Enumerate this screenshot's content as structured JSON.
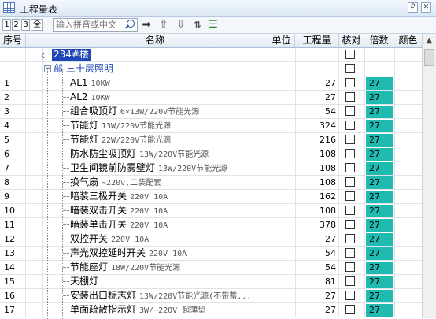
{
  "window": {
    "title": "工程量表",
    "pin_label": "₽",
    "close_label": "✕"
  },
  "toolbar": {
    "levels": [
      "1",
      "2",
      "3",
      "全"
    ],
    "search_placeholder": "输入拼音或中文",
    "icons": [
      "arrow-right-icon",
      "arrow-up-icon",
      "arrow-down-icon",
      "sort-icon",
      "list-check-icon"
    ]
  },
  "columns": {
    "seq": "序号",
    "name": "名称",
    "unit": "单位",
    "qty": "工程量",
    "check": "核对",
    "mult": "倍数",
    "color": "颜色"
  },
  "tree": {
    "root": {
      "prefix": "X",
      "label": "234#楼"
    },
    "group": {
      "prefix": "部",
      "label": "三十层照明"
    }
  },
  "rows": [
    {
      "no": "1",
      "name": "AL1",
      "spec": "10KW",
      "qty": "27",
      "mult": "27"
    },
    {
      "no": "2",
      "name": "AL2",
      "spec": "10KW",
      "qty": "27",
      "mult": "27"
    },
    {
      "no": "3",
      "name": "组合吸顶灯",
      "spec": "6×13W/220V节能光源",
      "qty": "54",
      "mult": "27"
    },
    {
      "no": "4",
      "name": "节能灯",
      "spec": "13W/220V节能光源",
      "qty": "324",
      "mult": "27"
    },
    {
      "no": "5",
      "name": "节能灯",
      "spec": "22W/220V节能光源",
      "qty": "216",
      "mult": "27"
    },
    {
      "no": "6",
      "name": "防水防尘吸顶灯",
      "spec": "13W/220V节能光源",
      "qty": "108",
      "mult": "27"
    },
    {
      "no": "7",
      "name": "卫生间镜前防雾壁灯",
      "spec": "13W/220V节能光源",
      "qty": "108",
      "mult": "27"
    },
    {
      "no": "8",
      "name": "换气扇",
      "spec": "~220v,二装配套",
      "qty": "108",
      "mult": "27"
    },
    {
      "no": "9",
      "name": "暗装三极开关",
      "spec": "220V 10A",
      "qty": "162",
      "mult": "27"
    },
    {
      "no": "10",
      "name": "暗装双击开关",
      "spec": "220V 10A",
      "qty": "108",
      "mult": "27"
    },
    {
      "no": "11",
      "name": "暗装单击开关",
      "spec": "220V 10A",
      "qty": "378",
      "mult": "27"
    },
    {
      "no": "12",
      "name": "双控开关",
      "spec": "220V 10A",
      "qty": "27",
      "mult": "27"
    },
    {
      "no": "13",
      "name": "声光双控延时开关",
      "spec": "220V 10A",
      "qty": "54",
      "mult": "27"
    },
    {
      "no": "14",
      "name": "节能座灯",
      "spec": "18W/220V节能光源",
      "qty": "54",
      "mult": "27"
    },
    {
      "no": "15",
      "name": "天棚灯",
      "spec": "",
      "qty": "81",
      "mult": "27"
    },
    {
      "no": "16",
      "name": "安装出口标志灯",
      "spec": "13W/220V节能光源(不带蓄...",
      "qty": "27",
      "mult": "27"
    },
    {
      "no": "17",
      "name": "单面疏散指示灯",
      "spec": "3W/~220V 超薄型",
      "qty": "27",
      "mult": "27"
    }
  ],
  "colors": {
    "accent": "#1a3fb0",
    "mult_fill": "#1fbab0",
    "root_fill": "#1f46b8",
    "header_bg": "#e3eaf3"
  }
}
